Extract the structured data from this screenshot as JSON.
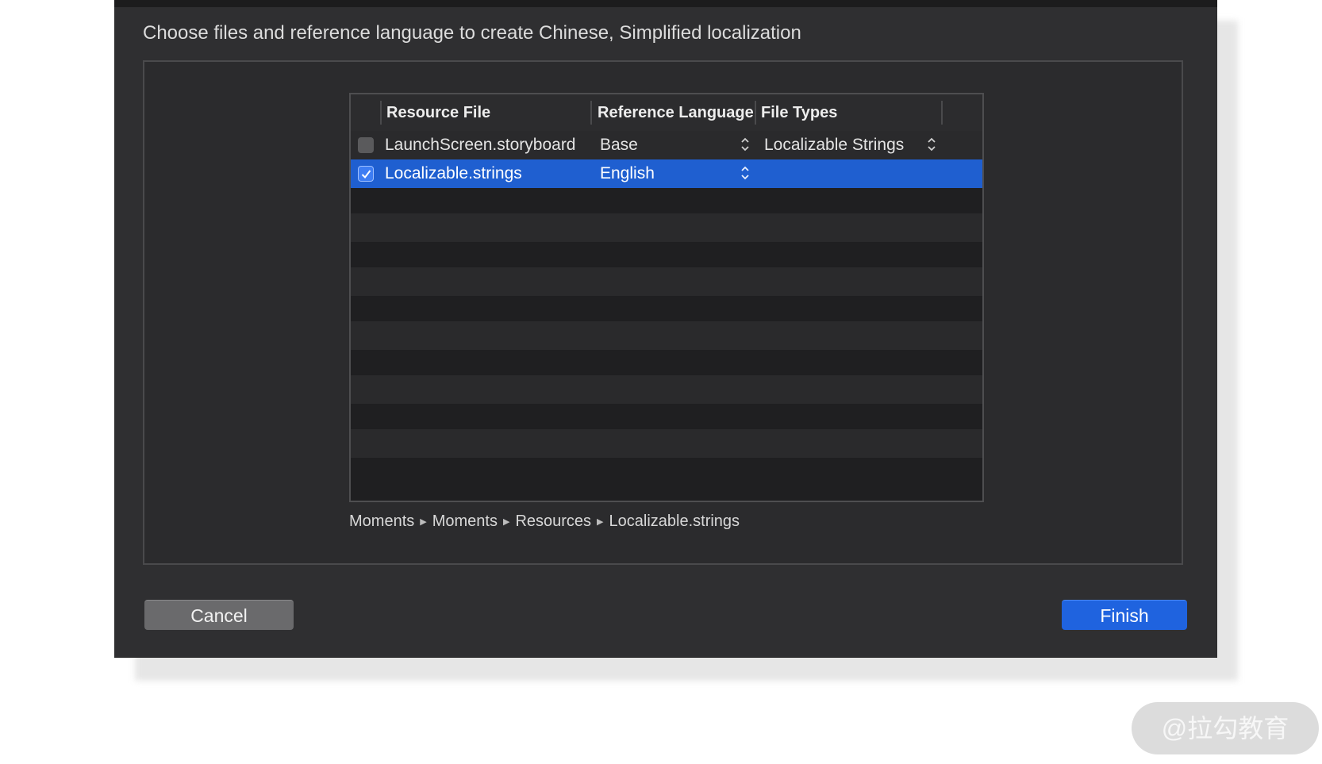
{
  "dialog": {
    "heading": "Choose files and reference language to create Chinese, Simplified localization"
  },
  "table": {
    "columns": [
      "Resource File",
      "Reference Language",
      "File Types"
    ],
    "rows": [
      {
        "checked": false,
        "file": "LaunchScreen.storyboard",
        "language": "Base",
        "file_type": "Localizable Strings",
        "selected": false
      },
      {
        "checked": true,
        "file": "Localizable.strings",
        "language": "English",
        "file_type": "",
        "selected": true
      }
    ]
  },
  "path": {
    "segments": [
      "Moments",
      "Moments",
      "Resources",
      "Localizable.strings"
    ],
    "separator_icon": "triangle-right-icon"
  },
  "buttons": {
    "cancel": "Cancel",
    "finish": "Finish"
  },
  "watermark": "@拉勾教育",
  "colors": {
    "selection": "#1f5fd0",
    "finish_button": "#1f63df",
    "sheet_background": "#2f2f31"
  }
}
